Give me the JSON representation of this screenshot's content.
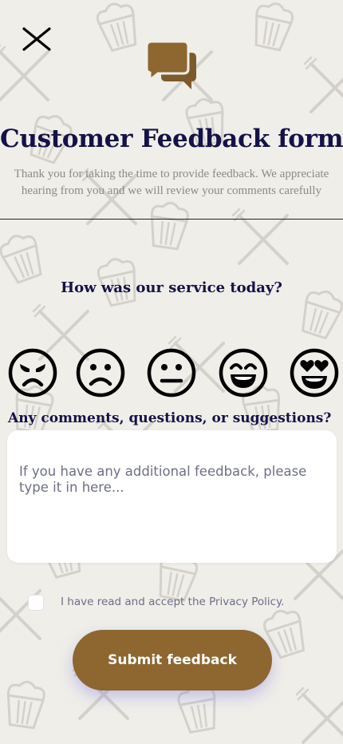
{
  "header": {
    "close_icon": "close-icon",
    "feedback_icon": "chat-bubbles-icon",
    "title": "Customer Feedback form",
    "subtitle": "Thank you for taking the time to provide feedback. We appreciate hearing from you and we will review your comments carefully"
  },
  "rating": {
    "question": "How was our service today?",
    "faces": [
      {
        "icon": "angry-face-icon"
      },
      {
        "icon": "sad-face-icon"
      },
      {
        "icon": "neutral-face-icon"
      },
      {
        "icon": "happy-face-icon"
      },
      {
        "icon": "heart-eyes-face-icon"
      }
    ]
  },
  "comments": {
    "label": "Any comments, questions, or suggestions?",
    "placeholder": "If you have any additional feedback, please type it in here..."
  },
  "privacy": {
    "checked": false,
    "label_prefix": "I have read and accept the ",
    "link": "Privacy Policy",
    "label_suffix": "."
  },
  "submit": {
    "label": "Submit feedback"
  },
  "colors": {
    "background": "#efeee9",
    "title": "#141247",
    "accent": "#8e6630",
    "subtitle": "#8a8a8a",
    "muted_text": "#6d6e88",
    "pattern": "#d6d4cd"
  }
}
